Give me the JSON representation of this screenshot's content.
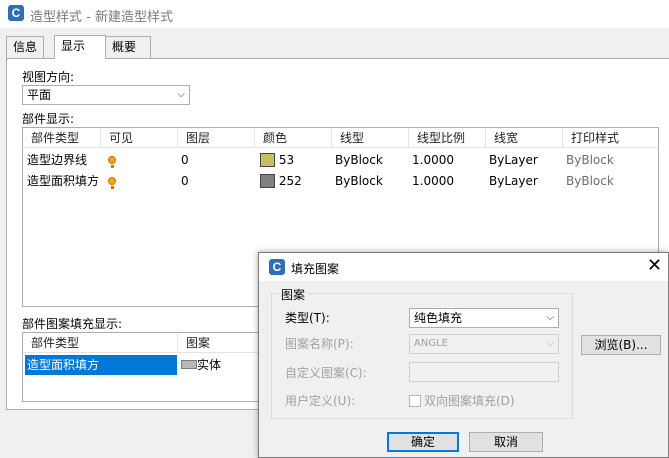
{
  "window": {
    "title": "造型样式 - 新建造型样式",
    "icon": "C"
  },
  "tabs": [
    {
      "label": "信息"
    },
    {
      "label": "显示"
    },
    {
      "label": "概要"
    }
  ],
  "view": {
    "label": "视图方向:",
    "value": "平面"
  },
  "components": {
    "label": "部件显示:",
    "headers": [
      "部件类型",
      "可见",
      "图层",
      "颜色",
      "线型",
      "线型比例",
      "线宽",
      "打印样式"
    ],
    "rows": [
      {
        "type": "造型边界线",
        "visible": true,
        "layer": "0",
        "color_hex": "#c8c060",
        "color": "53",
        "linetype": "ByBlock",
        "scale": "1.0000",
        "lineweight": "ByLayer",
        "plot": "ByBlock"
      },
      {
        "type": "造型面积填方",
        "visible": true,
        "layer": "0",
        "color_hex": "#808080",
        "color": "252",
        "linetype": "ByBlock",
        "scale": "1.0000",
        "lineweight": "ByLayer",
        "plot": "ByBlock"
      }
    ]
  },
  "hatch": {
    "label": "部件图案填充显示:",
    "headers": [
      "部件类型",
      "图案"
    ],
    "rows": [
      {
        "type": "造型面积填方",
        "pattern": "实体"
      }
    ]
  },
  "dialog": {
    "title": "填充图案",
    "icon": "C",
    "group": "图案",
    "type_label": "类型(T):",
    "type_value": "纯色填充",
    "name_label": "图案名称(P):",
    "name_value": "ANGLE",
    "browse": "浏览(B)...",
    "custom_label": "自定义图案(C):",
    "user_label": "用户定义(U):",
    "double": "双向图案填充(D)",
    "ok": "确定",
    "cancel": "取消"
  },
  "colors": {
    "selection": "#0078d7",
    "bulb": "#f2a900"
  }
}
